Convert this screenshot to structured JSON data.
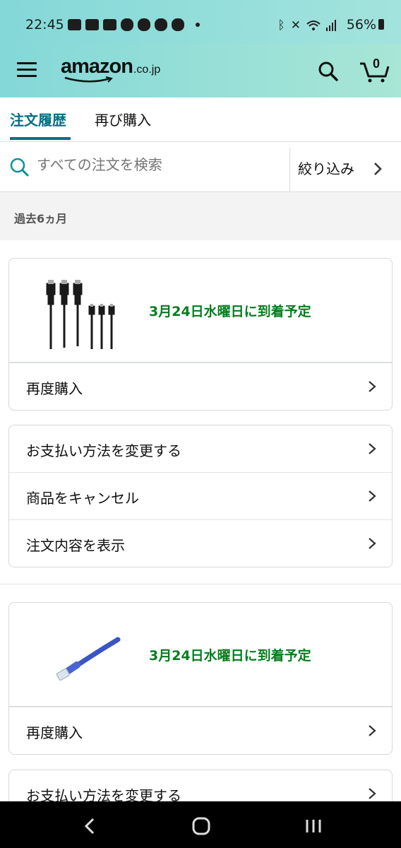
{
  "status_bar": {
    "time": "22:45",
    "battery": "56%",
    "icons_left": [
      "news-icon",
      "youtube-icon",
      "app-icon",
      "game-icon",
      "game-icon",
      "game-icon",
      "game-icon"
    ],
    "icons_right": [
      "bluetooth-icon",
      "mute-icon",
      "wifi-icon",
      "signal-icon",
      "battery-icon"
    ]
  },
  "header": {
    "logo_text": "amazon",
    "logo_suffix": ".co.jp",
    "cart_count": "0"
  },
  "tabs": [
    {
      "label": "注文履歴",
      "active": true
    },
    {
      "label": "再び購入",
      "active": false
    }
  ],
  "search": {
    "placeholder": "すべての注文を検索",
    "filter_label": "絞り込み"
  },
  "section": {
    "title": "過去6ヵ月"
  },
  "orders": [
    {
      "delivery": "3月24日水曜日に到着予定",
      "product_image": "usb-cables",
      "buy_again": "再度購入",
      "actions": [
        "お支払い方法を変更する",
        "商品をキャンセル",
        "注文内容を表示"
      ]
    },
    {
      "delivery": "3月24日水曜日に到着予定",
      "product_image": "lan-cable",
      "buy_again": "再度購入",
      "actions": [
        "お支払い方法を変更する"
      ]
    }
  ],
  "colors": {
    "header_bg": "#84d8d8",
    "accent": "#007185",
    "delivery_green": "#067D1E"
  }
}
